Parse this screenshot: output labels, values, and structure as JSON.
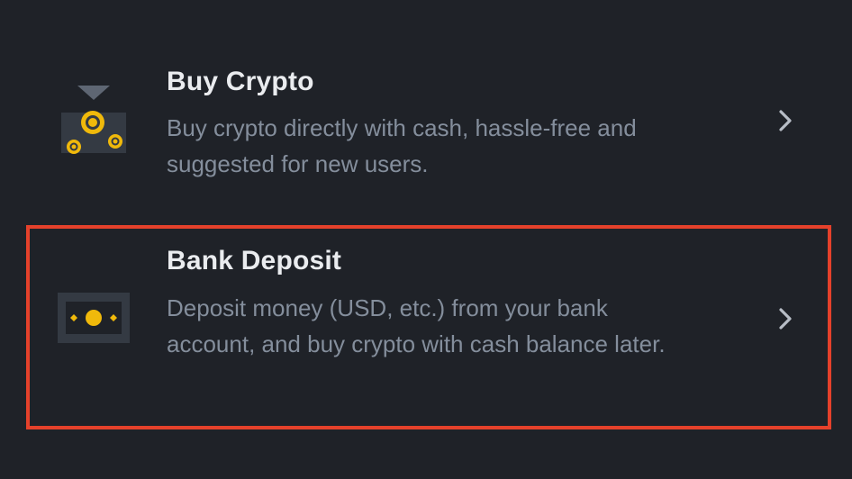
{
  "options": [
    {
      "title": "Buy Crypto",
      "description": "Buy crypto directly with cash, hassle-free and suggested for new users.",
      "icon": "buy-crypto-coins-icon"
    },
    {
      "title": "Bank Deposit",
      "description": "Deposit money (USD, etc.) from your bank account, and buy crypto with cash balance later.",
      "icon": "banknote-icon"
    }
  ],
  "colors": {
    "background": "#1f2228",
    "title": "#eaecef",
    "description": "#848e9c",
    "chevron": "#b7bdc6",
    "icon_panel": "#2b3139",
    "icon_gold": "#f0b90b",
    "highlight": "#e5412b"
  }
}
